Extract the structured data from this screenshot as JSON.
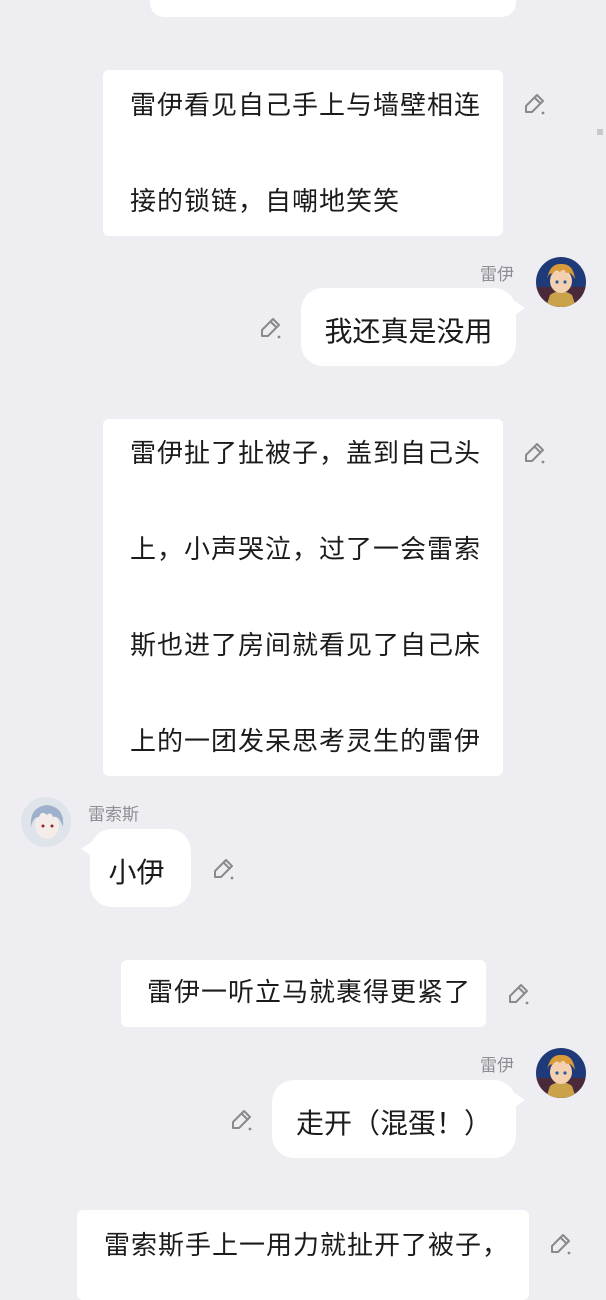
{
  "messages": [
    {
      "type": "narration",
      "lines": [
        "雷伊看见自己手上与墙壁相连",
        "接的锁链，自嘲地笑笑"
      ]
    },
    {
      "type": "chat",
      "sender": "雷伊",
      "side": "right",
      "text": "我还真是没用"
    },
    {
      "type": "narration",
      "lines": [
        "雷伊扯了扯被子，盖到自己头",
        "上，小声哭泣，过了一会雷索",
        "斯也进了房间就看见了自己床",
        "上的一团发呆思考灵生的雷伊"
      ]
    },
    {
      "type": "chat",
      "sender": "雷索斯",
      "side": "left",
      "text": "小伊"
    },
    {
      "type": "narration",
      "lines": [
        "雷伊一听立马就裹得更紧了"
      ]
    },
    {
      "type": "chat",
      "sender": "雷伊",
      "side": "right",
      "text": "走开（混蛋！）"
    },
    {
      "type": "narration",
      "lines": [
        "雷索斯手上一用力就扯开了被子，"
      ]
    }
  ],
  "icons": {
    "edit": "edit-pencil-icon",
    "avatar_rey": "avatar-rey",
    "avatar_reisos": "avatar-reisos"
  },
  "colors": {
    "background": "#ededf2",
    "bubble": "#ffffff",
    "name": "#8e8e93",
    "icon": "#8a8a8e"
  }
}
